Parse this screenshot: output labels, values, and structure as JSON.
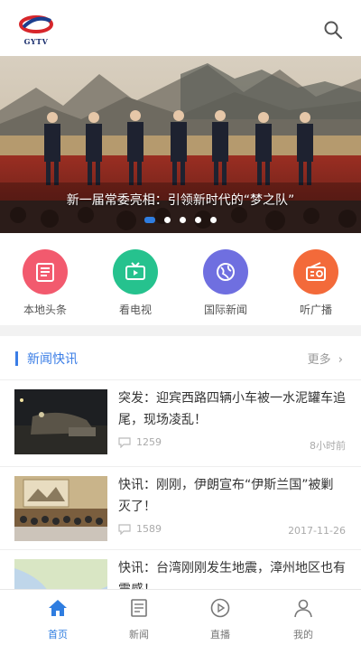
{
  "app": {
    "logo_text": "GYTV"
  },
  "banner": {
    "caption": "新一届常委亮相：引领新时代的“梦之队”",
    "slide_count": 5,
    "active_slide": 1
  },
  "categories": [
    {
      "label": "本地头条",
      "icon": "newspaper-icon",
      "color": "#f25a6e"
    },
    {
      "label": "看电视",
      "icon": "tv-icon",
      "color": "#26c28e"
    },
    {
      "label": "国际新闻",
      "icon": "globe-icon",
      "color": "#6f6fe0"
    },
    {
      "label": "听广播",
      "icon": "radio-icon",
      "color": "#f36a3a"
    }
  ],
  "section": {
    "title": "新闻快讯",
    "more": "更多"
  },
  "news": [
    {
      "title": "突发：迎宾西路四辆小车被一水泥罐车追尾，现场凌乱！",
      "comments": "1259",
      "time": "8小时前"
    },
    {
      "title": "快讯：刚刚，伊朗宣布“伊斯兰国”被剿灭了！",
      "comments": "1589",
      "time": "2017-11-26"
    },
    {
      "title": "快讯：台湾刚刚发生地震，漳州地区也有震感！",
      "comments": "",
      "time": ""
    }
  ],
  "tabs": [
    {
      "label": "首页",
      "icon": "home-icon",
      "active": true
    },
    {
      "label": "新闻",
      "icon": "news-icon",
      "active": false
    },
    {
      "label": "直播",
      "icon": "play-icon",
      "active": false
    },
    {
      "label": "我的",
      "icon": "user-icon",
      "active": false
    }
  ],
  "colors": {
    "accent": "#2f7de0",
    "section_accent": "#3a7de6"
  }
}
